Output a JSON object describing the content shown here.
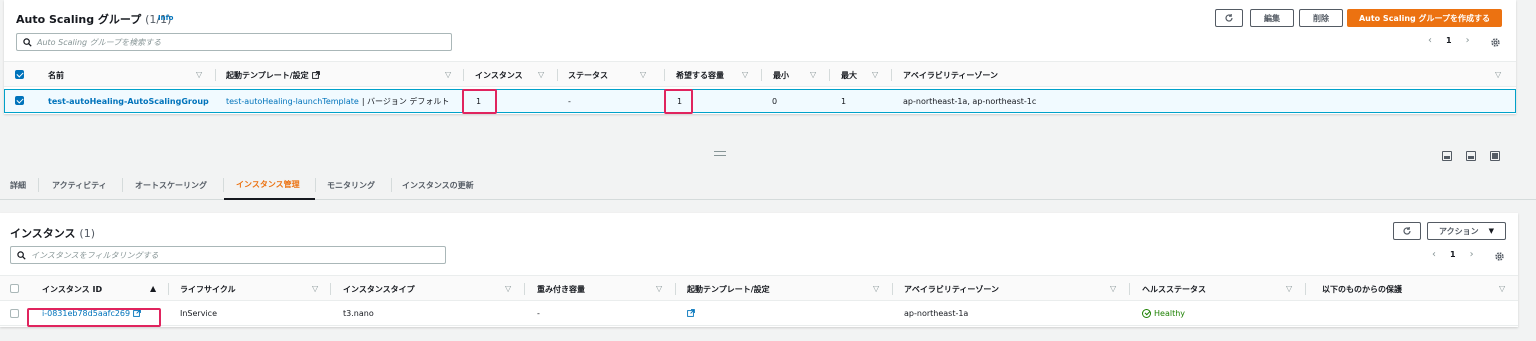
{
  "asg_panel": {
    "title": "Auto Scaling グループ",
    "count": "(1/1)",
    "info": "Info",
    "edit_label": "編集",
    "delete_label": "削除",
    "create_label": "Auto Scaling グループを作成する",
    "search_placeholder": "Auto Scaling グループを検索する",
    "page": "1",
    "columns": [
      "名前",
      "起動テンプレート/設定",
      "インスタンス",
      "ステータス",
      "希望する容量",
      "最小",
      "最大",
      "アベイラビリティーゾーン"
    ],
    "row": {
      "name": "test-autoHealing-AutoScalingGroup",
      "template_link": "test-autoHealing-launchTemplate",
      "template_version": "| バージョン デフォルト",
      "instances": "1",
      "status": "-",
      "desired": "1",
      "min": "0",
      "max": "1",
      "azs": "ap-northeast-1a, ap-northeast-1c"
    }
  },
  "tabs": [
    "詳細",
    "アクティビティ",
    "オートスケーリング",
    "インスタンス管理",
    "モニタリング",
    "インスタンスの更新"
  ],
  "active_tab": "インスタンス管理",
  "instances_panel": {
    "title": "インスタンス",
    "count": "(1)",
    "action_label": "アクション",
    "search_placeholder": "インスタンスをフィルタリングする",
    "page": "1",
    "columns": [
      "インスタンス ID",
      "ライフサイクル",
      "インスタンスタイプ",
      "重み付き容量",
      "起動テンプレート/設定",
      "アベイラビリティーゾーン",
      "ヘルスステータス",
      "以下のものからの保護"
    ],
    "row": {
      "instance_id": "i-0831eb78d5aafc269",
      "lifecycle": "InService",
      "instance_type": "t3.nano",
      "weight": "-",
      "az": "ap-northeast-1a",
      "health": "Healthy"
    }
  },
  "colors": {
    "accent": "#ec7211",
    "link": "#0073bb",
    "healthy": "#1d8102",
    "highlight": "#e0245e"
  }
}
